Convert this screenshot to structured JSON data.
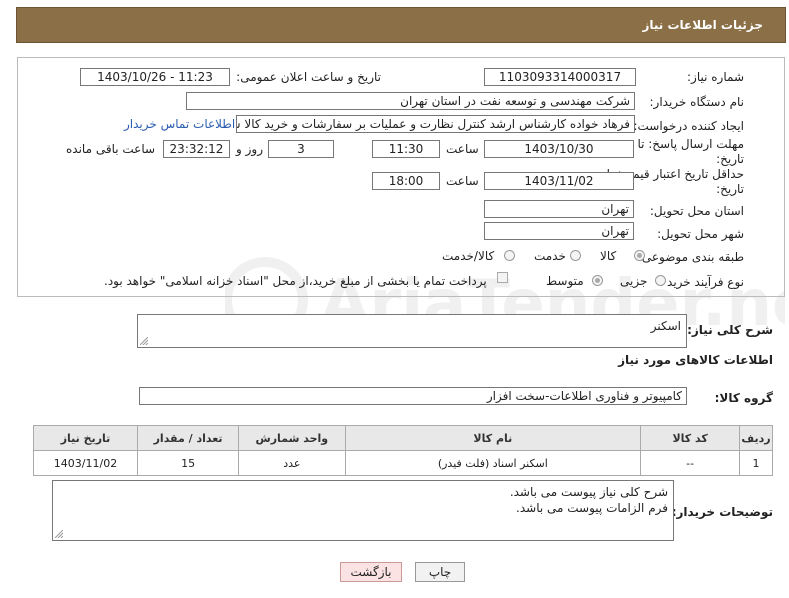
{
  "header": {
    "title": "جزئیات اطلاعات نیاز"
  },
  "form": {
    "need_number": {
      "label": "شماره نیاز:",
      "value": "1103093314000317"
    },
    "announce_datetime": {
      "label": "تاریخ و ساعت اعلان عمومی:",
      "value": "1403/10/26 - 11:23"
    },
    "buyer_org": {
      "label": "نام دستگاه خریدار:",
      "value": "شرکت مهندسی و توسعه نفت در استان تهران"
    },
    "requester": {
      "label": "ایجاد کننده درخواست:",
      "value": "فرهاد خواده کارشناس ارشد کنترل نظارت و عملیات بر سفارشات و خرید کالا شر",
      "contact_link": "اطلاعات تماس خریدار"
    },
    "reply_deadline": {
      "label_line1": "مهلت ارسال پاسخ: تا",
      "label_line2": "تاریخ:",
      "date": "1403/10/30",
      "time_label": "ساعت",
      "time": "11:30",
      "days": "3",
      "days_label": "روز و",
      "remaining": "23:32:12",
      "remaining_label": "ساعت باقی مانده"
    },
    "price_validity": {
      "label_line1": "حداقل تاریخ اعتبار قیمت: تا",
      "label_line2": "تاریخ:",
      "date": "1403/11/02",
      "time_label": "ساعت",
      "time": "18:00"
    },
    "delivery_province": {
      "label": "استان محل تحویل:",
      "value": "تهران"
    },
    "delivery_city": {
      "label": "شهر محل تحویل:",
      "value": "تهران"
    },
    "category": {
      "label": "طبقه بندی موضوعی:",
      "options": [
        "کالا",
        "خدمت",
        "کالا/خدمت"
      ]
    },
    "purchase_type": {
      "label": "نوع فرآیند خرید :",
      "options": [
        "جزیی",
        "متوسط"
      ],
      "payment_note": "پرداخت تمام یا بخشی از مبلغ خرید،از محل \"اسناد خزانه اسلامی\" خواهد بود."
    }
  },
  "need_description": {
    "label": "شرح کلی نیاز:",
    "value": "اسکنر"
  },
  "goods_info_title": "اطلاعات کالاهای مورد نیاز",
  "goods_group": {
    "label": "گروه کالا:",
    "value": "کامپیوتر و فناوری اطلاعات-سخت افزار"
  },
  "table": {
    "headers": [
      "ردیف",
      "کد کالا",
      "نام کالا",
      "واحد شمارش",
      "تعداد / مقدار",
      "تاریخ نیاز"
    ],
    "rows": [
      [
        "1",
        "--",
        "اسکنر اسناد (فلت فیدر)",
        "عدد",
        "15",
        "1403/11/02"
      ]
    ]
  },
  "buyer_notes": {
    "label": "توضیحات خریدار:",
    "line1": "شرح کلی نیاز پیوست می باشد.",
    "line2": "فرم الزامات پیوست می باشد."
  },
  "buttons": {
    "print": "چاپ",
    "back": "بازگشت"
  },
  "watermark_text": "AriaTender.neT"
}
